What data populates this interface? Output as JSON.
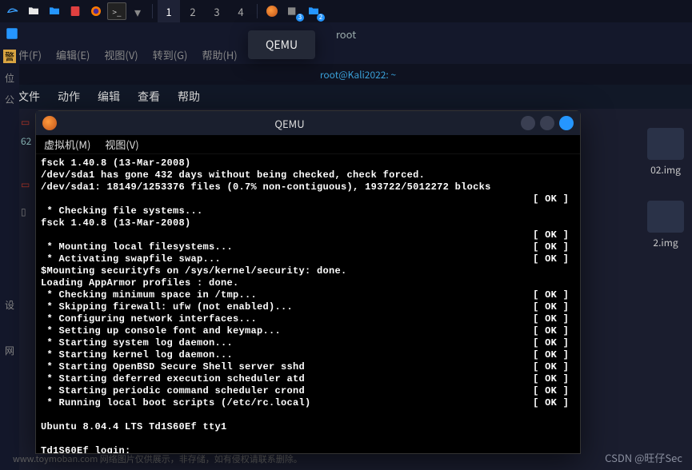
{
  "sysbar": {
    "workspaces": [
      "1",
      "2",
      "3",
      "4"
    ],
    "active_ws": 0
  },
  "rootwin": {
    "title": "root"
  },
  "rootmenu": [
    "文件(F)",
    "编辑(E)",
    "视图(V)",
    "转到(G)",
    "帮助(H)"
  ],
  "termtitle": "root@Kali2022: ~",
  "termmenu": [
    "文件",
    "动作",
    "编辑",
    "查看",
    "帮助"
  ],
  "lefttool": [
    "警",
    "位",
    "公"
  ],
  "sidefiles": {
    "num": "62"
  },
  "tooltip": "QEMU",
  "bgfiles": [
    "02.img",
    "2.img"
  ],
  "qemu": {
    "title": "QEMU",
    "menu": [
      "虚拟机(M)",
      "视图(V)"
    ],
    "lines": [
      {
        "t": "fsck 1.40.8 (13-Mar-2008)"
      },
      {
        "t": "/dev/sda1 has gone 432 days without being checked, check forced."
      },
      {
        "t": "/dev/sda1: 18149/1253376 files (0.7% non-contiguous), 193722/5012272 blocks"
      },
      {
        "t": "",
        "ok": "[ OK ]"
      },
      {
        "t": " * Checking file systems..."
      },
      {
        "t": "fsck 1.40.8 (13-Mar-2008)"
      },
      {
        "t": "",
        "ok": "[ OK ]"
      },
      {
        "t": " * Mounting local filesystems...",
        "ok": "[ OK ]"
      },
      {
        "t": " * Activating swapfile swap...",
        "ok": "[ OK ]"
      },
      {
        "t": "$Mounting securityfs on /sys/kernel/security: done."
      },
      {
        "t": "Loading AppArmor profiles : done."
      },
      {
        "t": " * Checking minimum space in /tmp...",
        "ok": "[ OK ]"
      },
      {
        "t": " * Skipping firewall: ufw (not enabled)...",
        "ok": "[ OK ]"
      },
      {
        "t": " * Configuring network interfaces...",
        "ok": "[ OK ]"
      },
      {
        "t": " * Setting up console font and keymap...",
        "ok": "[ OK ]"
      },
      {
        "t": " * Starting system log daemon...",
        "ok": "[ OK ]"
      },
      {
        "t": " * Starting kernel log daemon...",
        "ok": "[ OK ]"
      },
      {
        "t": " * Starting OpenBSD Secure Shell server sshd",
        "ok": "[ OK ]"
      },
      {
        "t": " * Starting deferred execution scheduler atd",
        "ok": "[ OK ]"
      },
      {
        "t": " * Starting periodic command scheduler crond",
        "ok": "[ OK ]"
      },
      {
        "t": " * Running local boot scripts (/etc/rc.local)",
        "ok": "[ OK ]"
      },
      {
        "t": ""
      },
      {
        "t": "Ubuntu 8.04.4 LTS Td1S60Ef tty1"
      },
      {
        "t": ""
      },
      {
        "t": "Td1S60Ef login: _"
      }
    ]
  },
  "watermark": "CSDN @旺仔Sec",
  "footer": "www.toymoban.com 网络图片仅供展示，非存储，如有侵权请联系删除。"
}
